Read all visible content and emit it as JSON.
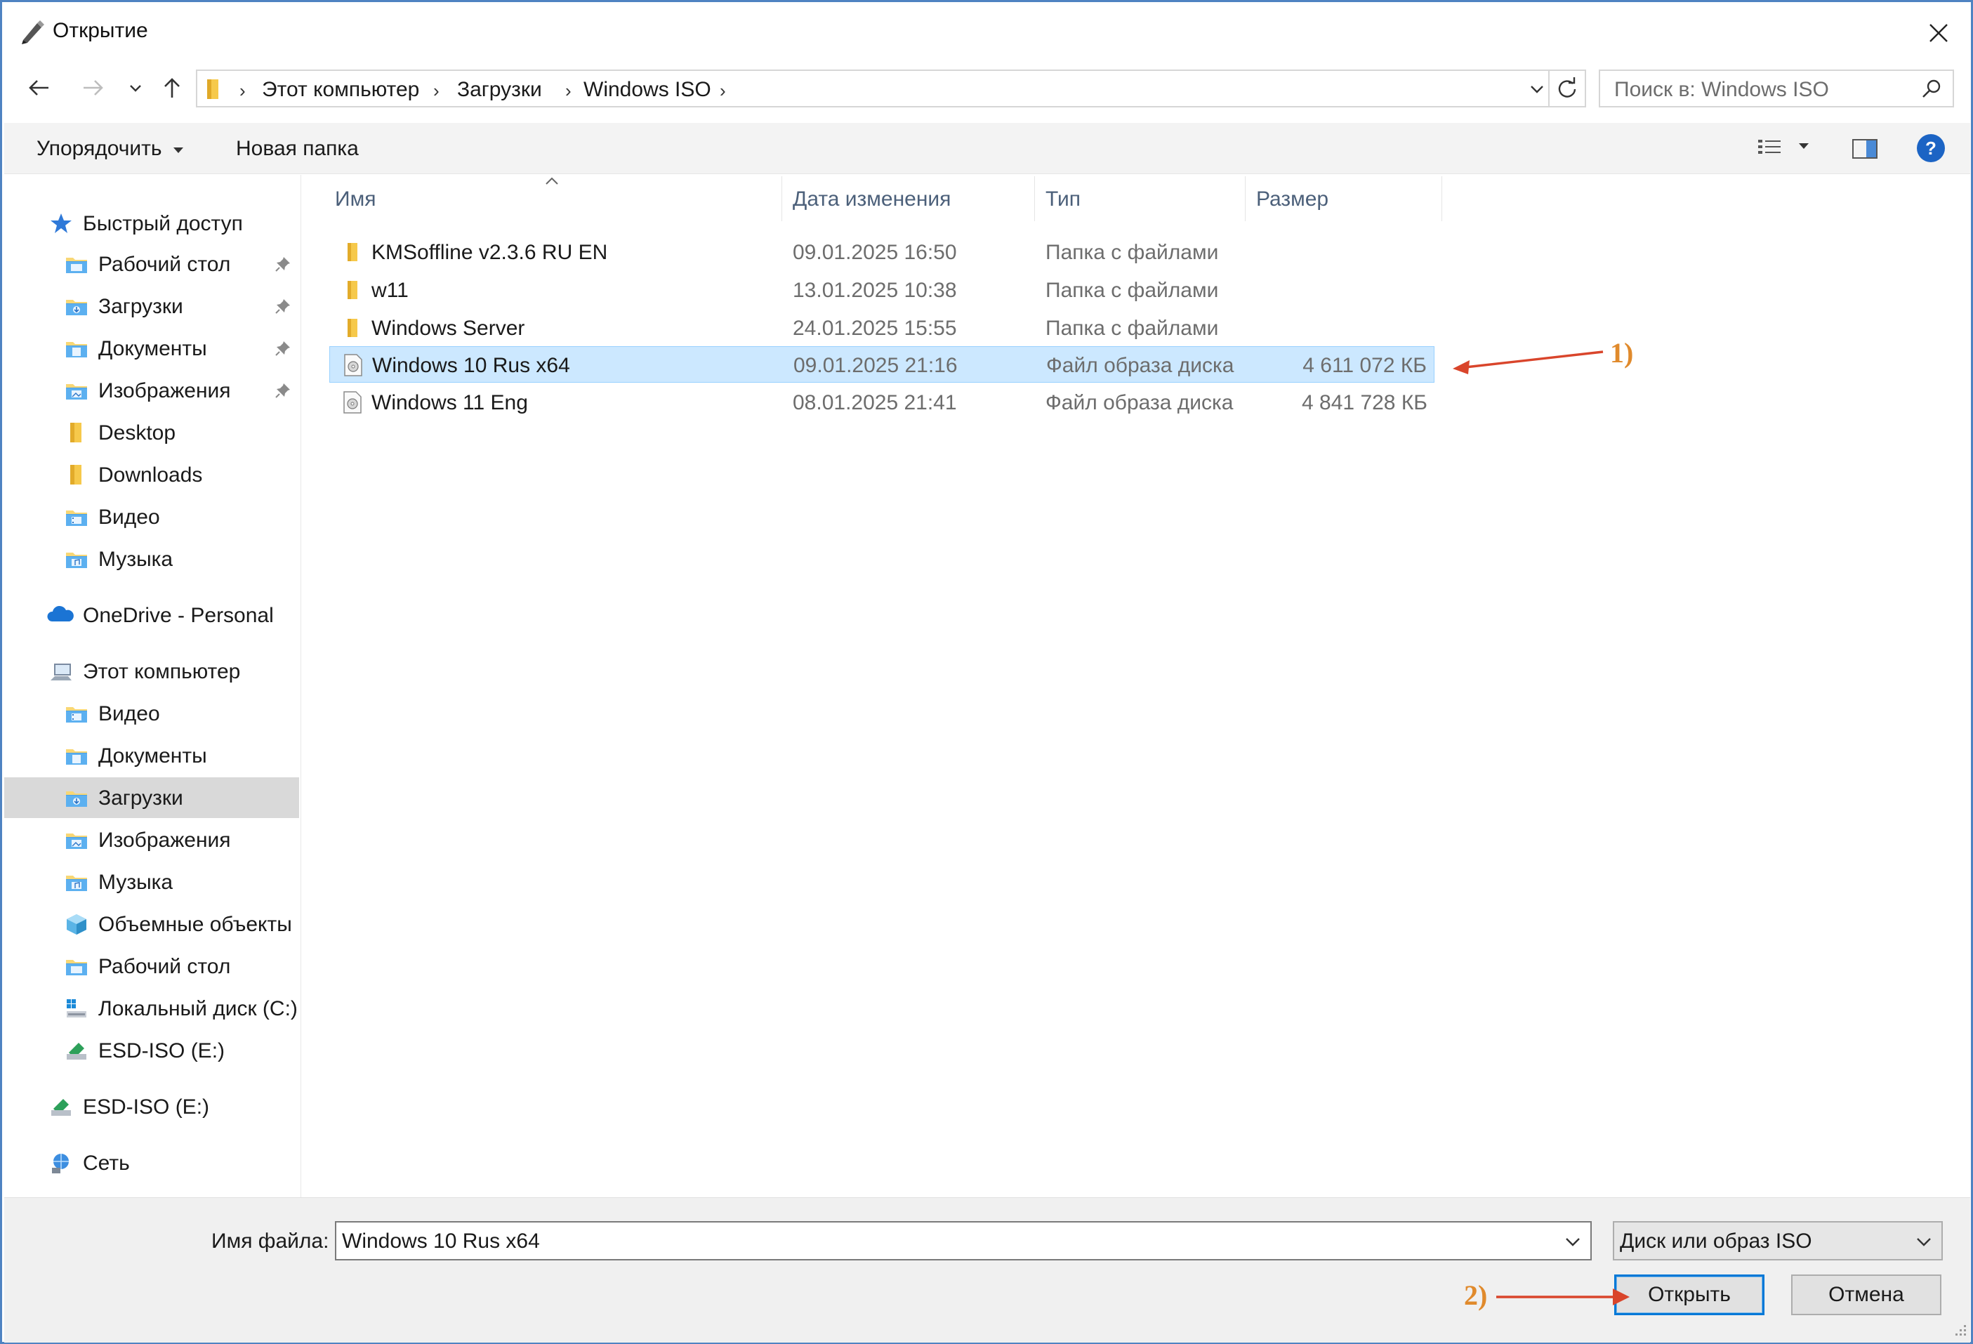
{
  "window": {
    "title": "Открытие"
  },
  "address": {
    "crumbs": [
      "Этот компьютер",
      "Загрузки",
      "Windows ISO"
    ]
  },
  "search": {
    "placeholder": "Поиск в: Windows ISO"
  },
  "toolbar": {
    "organize_label": "Упорядочить",
    "new_folder_label": "Новая папка"
  },
  "sidebar": {
    "items": [
      {
        "label": "Быстрый доступ",
        "icon": "star-icon"
      },
      {
        "label": "Рабочий стол",
        "icon": "desktop-folder-icon",
        "pinned": true
      },
      {
        "label": "Загрузки",
        "icon": "downloads-folder-icon",
        "pinned": true
      },
      {
        "label": "Документы",
        "icon": "documents-folder-icon",
        "pinned": true
      },
      {
        "label": "Изображения",
        "icon": "pictures-folder-icon",
        "pinned": true
      },
      {
        "label": "Desktop",
        "icon": "folder-icon"
      },
      {
        "label": "Downloads",
        "icon": "folder-icon"
      },
      {
        "label": "Видео",
        "icon": "videos-folder-icon"
      },
      {
        "label": "Музыка",
        "icon": "music-folder-icon"
      },
      {
        "label": "OneDrive - Personal",
        "icon": "cloud-icon"
      },
      {
        "label": "Этот компьютер",
        "icon": "computer-icon"
      },
      {
        "label": "Видео",
        "icon": "videos-folder-icon"
      },
      {
        "label": "Документы",
        "icon": "documents-folder-icon"
      },
      {
        "label": "Загрузки",
        "icon": "downloads-folder-icon",
        "selected": true
      },
      {
        "label": "Изображения",
        "icon": "pictures-folder-icon"
      },
      {
        "label": "Музыка",
        "icon": "music-folder-icon"
      },
      {
        "label": "Объемные объекты",
        "icon": "3d-objects-icon"
      },
      {
        "label": "Рабочий стол",
        "icon": "desktop-folder-icon"
      },
      {
        "label": "Локальный диск (C:)",
        "icon": "drive-icon"
      },
      {
        "label": "ESD-ISO (E:)",
        "icon": "usb-drive-icon"
      },
      {
        "label": "ESD-ISO (E:)",
        "icon": "usb-drive-icon"
      },
      {
        "label": "Сеть",
        "icon": "network-icon"
      }
    ]
  },
  "columns": {
    "name": "Имя",
    "date": "Дата изменения",
    "type": "Тип",
    "size": "Размер"
  },
  "files": [
    {
      "name": "KMSoffline v2.3.6 RU EN",
      "date": "09.01.2025 16:50",
      "type": "Папка с файлами",
      "size": "",
      "icon": "folder-icon"
    },
    {
      "name": "w11",
      "date": "13.01.2025 10:38",
      "type": "Папка с файлами",
      "size": "",
      "icon": "folder-icon"
    },
    {
      "name": "Windows Server",
      "date": "24.01.2025 15:55",
      "type": "Папка с файлами",
      "size": "",
      "icon": "folder-icon"
    },
    {
      "name": "Windows 10 Rus x64",
      "date": "09.01.2025 21:16",
      "type": "Файл образа диска",
      "size": "4 611 072 КБ",
      "icon": "disc-image-icon",
      "selected": true
    },
    {
      "name": "Windows 11 Eng",
      "date": "08.01.2025 21:41",
      "type": "Файл образа диска",
      "size": "4 841 728 КБ",
      "icon": "disc-image-icon"
    }
  ],
  "footer": {
    "filename_label": "Имя файла:",
    "filename_value": "Windows 10 Rus x64",
    "filter_value": "Диск или образ ISO",
    "open_label": "Открыть",
    "cancel_label": "Отмена"
  },
  "annotations": {
    "label1": "1)",
    "label2": "2)",
    "color": "#e08a2c",
    "arrow_color": "#d9452b"
  },
  "colors": {
    "accent": "#0078d7",
    "selection_bg": "#cce8ff",
    "selection_border": "#99d1ff",
    "help": "#1c64c4"
  }
}
